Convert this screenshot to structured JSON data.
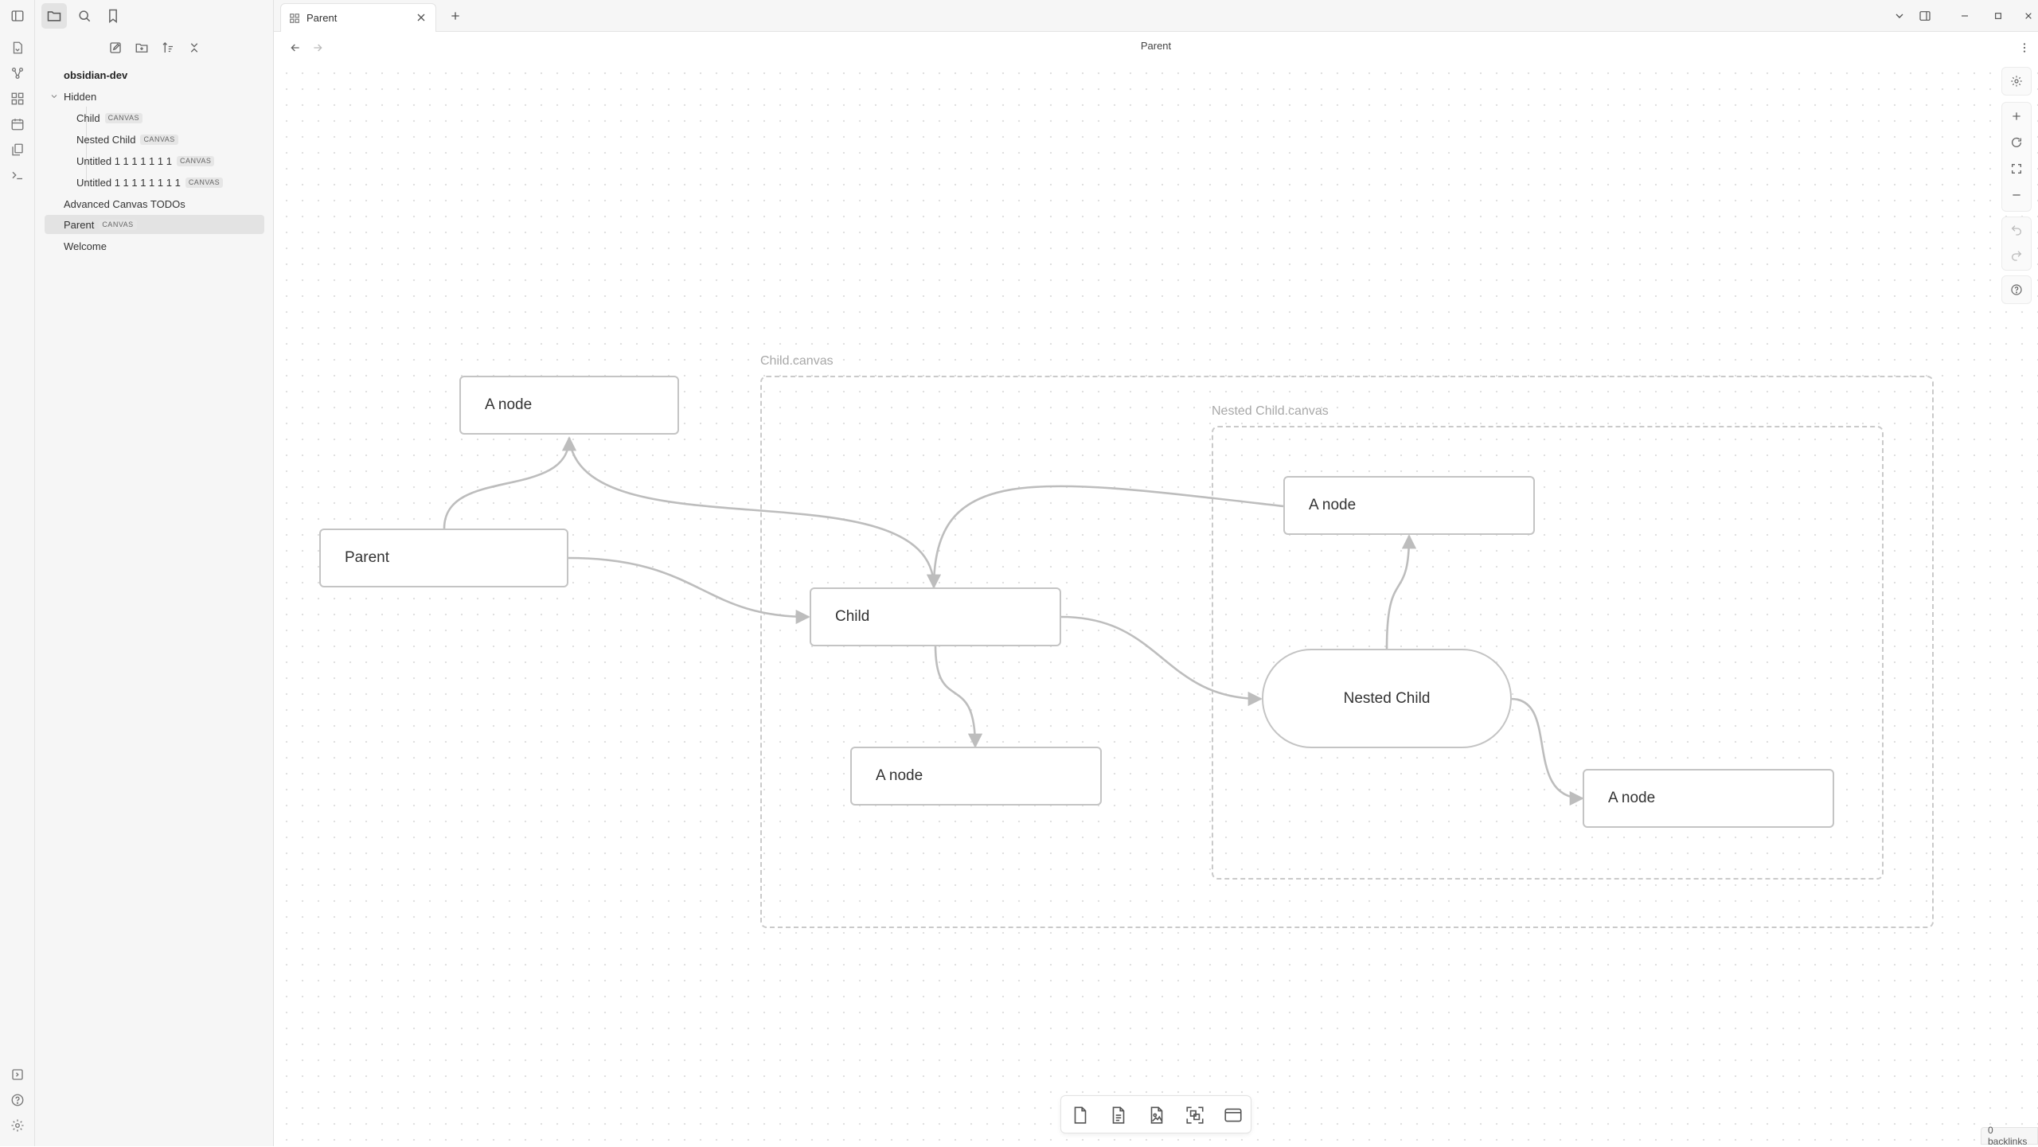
{
  "sidebar": {
    "vault_name": "obsidian-dev",
    "folder": "Hidden",
    "items": [
      {
        "label": "Child",
        "badge": "CANVAS"
      },
      {
        "label": "Nested Child",
        "badge": "CANVAS"
      },
      {
        "label": "Untitled 1 1 1 1 1 1 1",
        "badge": "CANVAS"
      },
      {
        "label": "Untitled 1 1 1 1 1 1 1 1",
        "badge": "CANVAS"
      }
    ],
    "root_items": [
      {
        "label": "Advanced Canvas TODOs",
        "badge": ""
      },
      {
        "label": "Parent",
        "badge": "CANVAS",
        "selected": true
      },
      {
        "label": "Welcome",
        "badge": ""
      }
    ]
  },
  "tabs": [
    {
      "label": "Parent"
    }
  ],
  "view": {
    "title": "Parent"
  },
  "canvas": {
    "groups": [
      {
        "label": "Child.canvas"
      },
      {
        "label": "Nested Child.canvas"
      }
    ],
    "nodes": [
      {
        "label": "A node"
      },
      {
        "label": "Parent"
      },
      {
        "label": "Child"
      },
      {
        "label": "A node"
      },
      {
        "label": "A node"
      },
      {
        "label": "Nested Child"
      },
      {
        "label": "A node"
      }
    ]
  },
  "status": {
    "backlinks": "0 backlinks"
  },
  "colors": {
    "edge": "#bdbdbd",
    "node_border": "#c4c4c4",
    "background": "#ffffff",
    "sidebar": "#f6f6f6"
  }
}
